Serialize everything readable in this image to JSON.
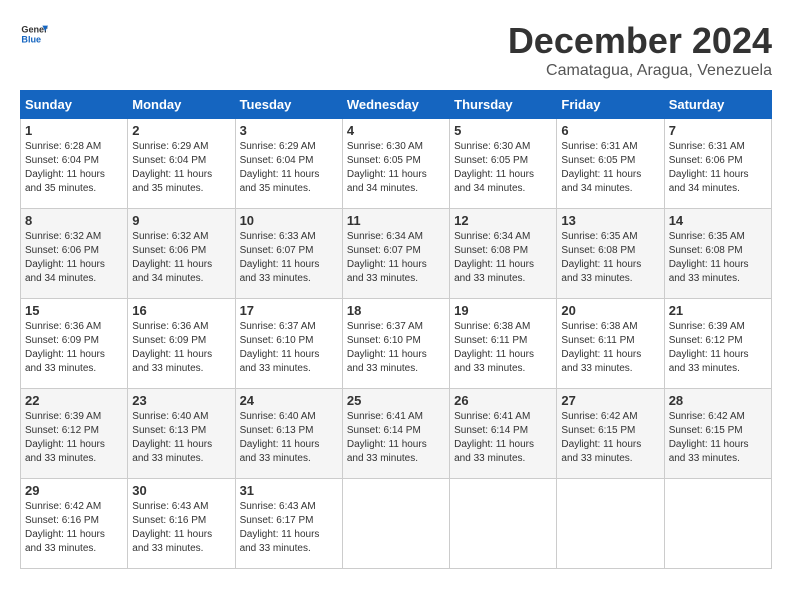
{
  "logo": {
    "line1": "General",
    "line2": "Blue"
  },
  "title": "December 2024",
  "location": "Camatagua, Aragua, Venezuela",
  "days_of_week": [
    "Sunday",
    "Monday",
    "Tuesday",
    "Wednesday",
    "Thursday",
    "Friday",
    "Saturday"
  ],
  "weeks": [
    [
      {
        "day": "1",
        "sunrise": "6:28 AM",
        "sunset": "6:04 PM",
        "daylight": "11 hours and 35 minutes."
      },
      {
        "day": "2",
        "sunrise": "6:29 AM",
        "sunset": "6:04 PM",
        "daylight": "11 hours and 35 minutes."
      },
      {
        "day": "3",
        "sunrise": "6:29 AM",
        "sunset": "6:04 PM",
        "daylight": "11 hours and 35 minutes."
      },
      {
        "day": "4",
        "sunrise": "6:30 AM",
        "sunset": "6:05 PM",
        "daylight": "11 hours and 34 minutes."
      },
      {
        "day": "5",
        "sunrise": "6:30 AM",
        "sunset": "6:05 PM",
        "daylight": "11 hours and 34 minutes."
      },
      {
        "day": "6",
        "sunrise": "6:31 AM",
        "sunset": "6:05 PM",
        "daylight": "11 hours and 34 minutes."
      },
      {
        "day": "7",
        "sunrise": "6:31 AM",
        "sunset": "6:06 PM",
        "daylight": "11 hours and 34 minutes."
      }
    ],
    [
      {
        "day": "8",
        "sunrise": "6:32 AM",
        "sunset": "6:06 PM",
        "daylight": "11 hours and 34 minutes."
      },
      {
        "day": "9",
        "sunrise": "6:32 AM",
        "sunset": "6:06 PM",
        "daylight": "11 hours and 34 minutes."
      },
      {
        "day": "10",
        "sunrise": "6:33 AM",
        "sunset": "6:07 PM",
        "daylight": "11 hours and 33 minutes."
      },
      {
        "day": "11",
        "sunrise": "6:34 AM",
        "sunset": "6:07 PM",
        "daylight": "11 hours and 33 minutes."
      },
      {
        "day": "12",
        "sunrise": "6:34 AM",
        "sunset": "6:08 PM",
        "daylight": "11 hours and 33 minutes."
      },
      {
        "day": "13",
        "sunrise": "6:35 AM",
        "sunset": "6:08 PM",
        "daylight": "11 hours and 33 minutes."
      },
      {
        "day": "14",
        "sunrise": "6:35 AM",
        "sunset": "6:08 PM",
        "daylight": "11 hours and 33 minutes."
      }
    ],
    [
      {
        "day": "15",
        "sunrise": "6:36 AM",
        "sunset": "6:09 PM",
        "daylight": "11 hours and 33 minutes."
      },
      {
        "day": "16",
        "sunrise": "6:36 AM",
        "sunset": "6:09 PM",
        "daylight": "11 hours and 33 minutes."
      },
      {
        "day": "17",
        "sunrise": "6:37 AM",
        "sunset": "6:10 PM",
        "daylight": "11 hours and 33 minutes."
      },
      {
        "day": "18",
        "sunrise": "6:37 AM",
        "sunset": "6:10 PM",
        "daylight": "11 hours and 33 minutes."
      },
      {
        "day": "19",
        "sunrise": "6:38 AM",
        "sunset": "6:11 PM",
        "daylight": "11 hours and 33 minutes."
      },
      {
        "day": "20",
        "sunrise": "6:38 AM",
        "sunset": "6:11 PM",
        "daylight": "11 hours and 33 minutes."
      },
      {
        "day": "21",
        "sunrise": "6:39 AM",
        "sunset": "6:12 PM",
        "daylight": "11 hours and 33 minutes."
      }
    ],
    [
      {
        "day": "22",
        "sunrise": "6:39 AM",
        "sunset": "6:12 PM",
        "daylight": "11 hours and 33 minutes."
      },
      {
        "day": "23",
        "sunrise": "6:40 AM",
        "sunset": "6:13 PM",
        "daylight": "11 hours and 33 minutes."
      },
      {
        "day": "24",
        "sunrise": "6:40 AM",
        "sunset": "6:13 PM",
        "daylight": "11 hours and 33 minutes."
      },
      {
        "day": "25",
        "sunrise": "6:41 AM",
        "sunset": "6:14 PM",
        "daylight": "11 hours and 33 minutes."
      },
      {
        "day": "26",
        "sunrise": "6:41 AM",
        "sunset": "6:14 PM",
        "daylight": "11 hours and 33 minutes."
      },
      {
        "day": "27",
        "sunrise": "6:42 AM",
        "sunset": "6:15 PM",
        "daylight": "11 hours and 33 minutes."
      },
      {
        "day": "28",
        "sunrise": "6:42 AM",
        "sunset": "6:15 PM",
        "daylight": "11 hours and 33 minutes."
      }
    ],
    [
      {
        "day": "29",
        "sunrise": "6:42 AM",
        "sunset": "6:16 PM",
        "daylight": "11 hours and 33 minutes."
      },
      {
        "day": "30",
        "sunrise": "6:43 AM",
        "sunset": "6:16 PM",
        "daylight": "11 hours and 33 minutes."
      },
      {
        "day": "31",
        "sunrise": "6:43 AM",
        "sunset": "6:17 PM",
        "daylight": "11 hours and 33 minutes."
      },
      null,
      null,
      null,
      null
    ]
  ]
}
